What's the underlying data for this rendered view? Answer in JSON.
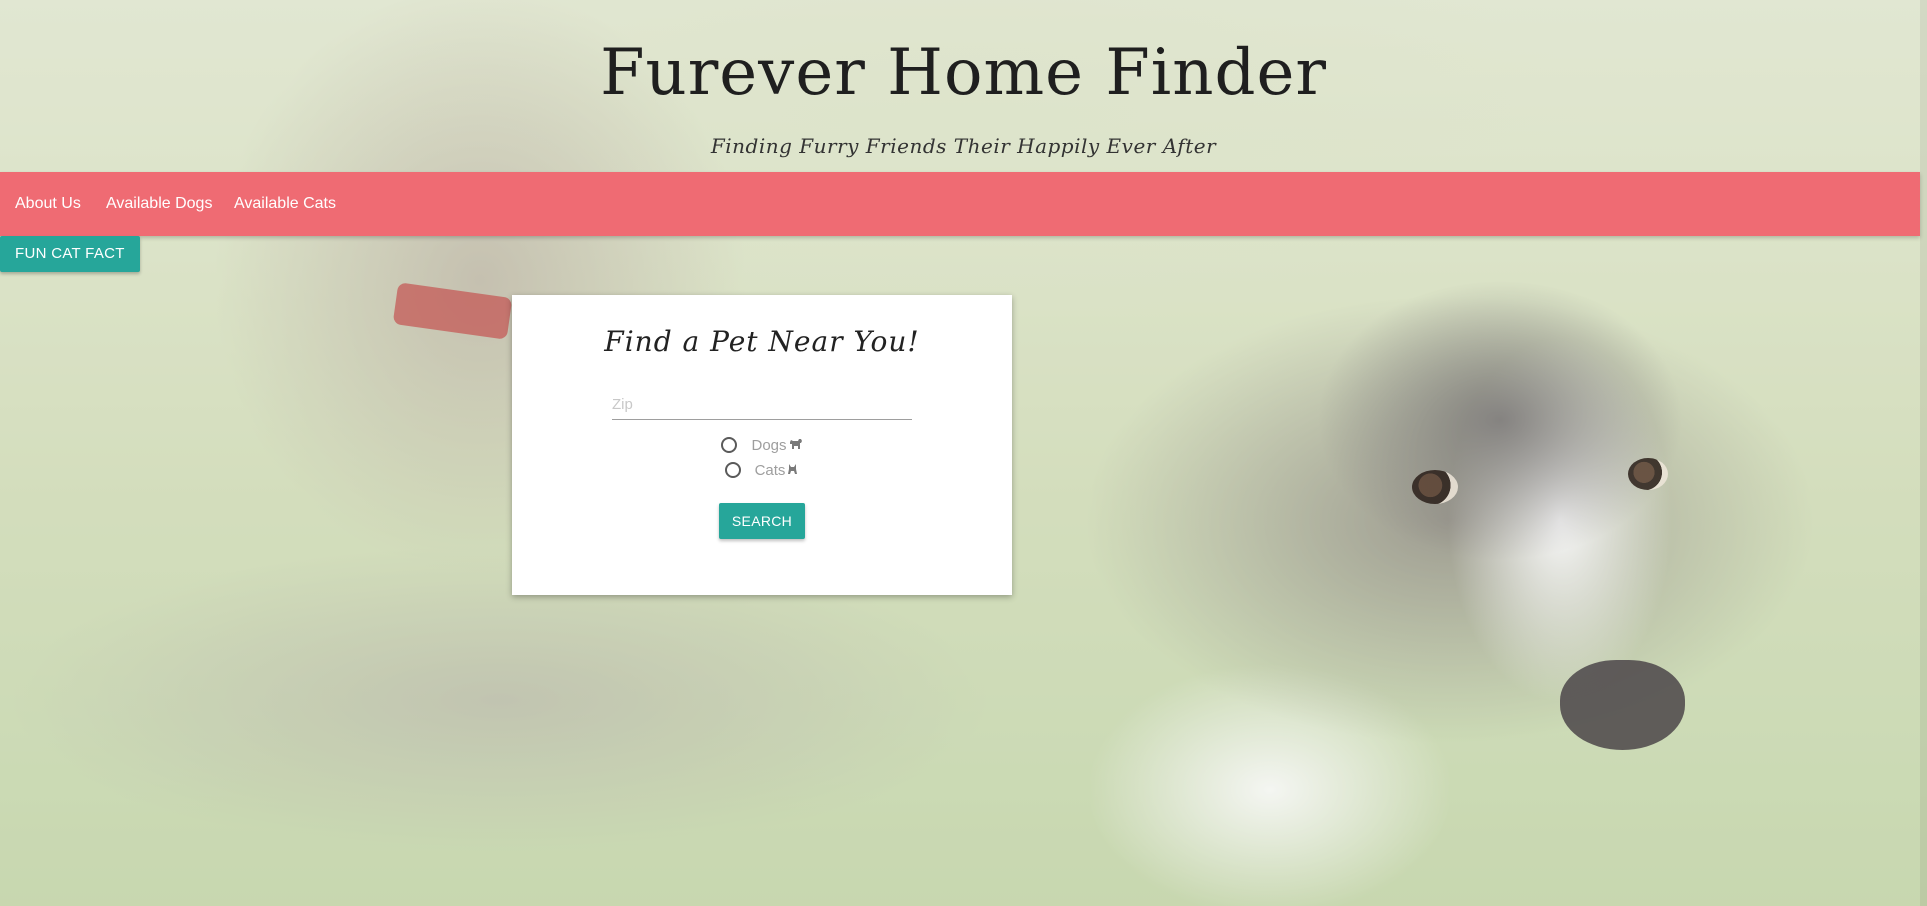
{
  "header": {
    "title": "Furever Home Finder",
    "tagline": "Finding Furry Friends Their Happily Ever After"
  },
  "nav": {
    "items": [
      {
        "label": "About Us"
      },
      {
        "label": "Available Dogs"
      },
      {
        "label": "Available Cats"
      }
    ],
    "background_color": "#ef6b73"
  },
  "fact_button": {
    "label": "FUN CAT FACT",
    "color": "#26a69a"
  },
  "search_card": {
    "title": "Find a Pet Near You!",
    "zip": {
      "value": "",
      "placeholder": "Zip"
    },
    "options": [
      {
        "label": "Dogs",
        "icon": "dog-icon",
        "selected": false
      },
      {
        "label": "Cats",
        "icon": "cat-icon",
        "selected": false
      }
    ],
    "search_label": "SEARCH"
  }
}
